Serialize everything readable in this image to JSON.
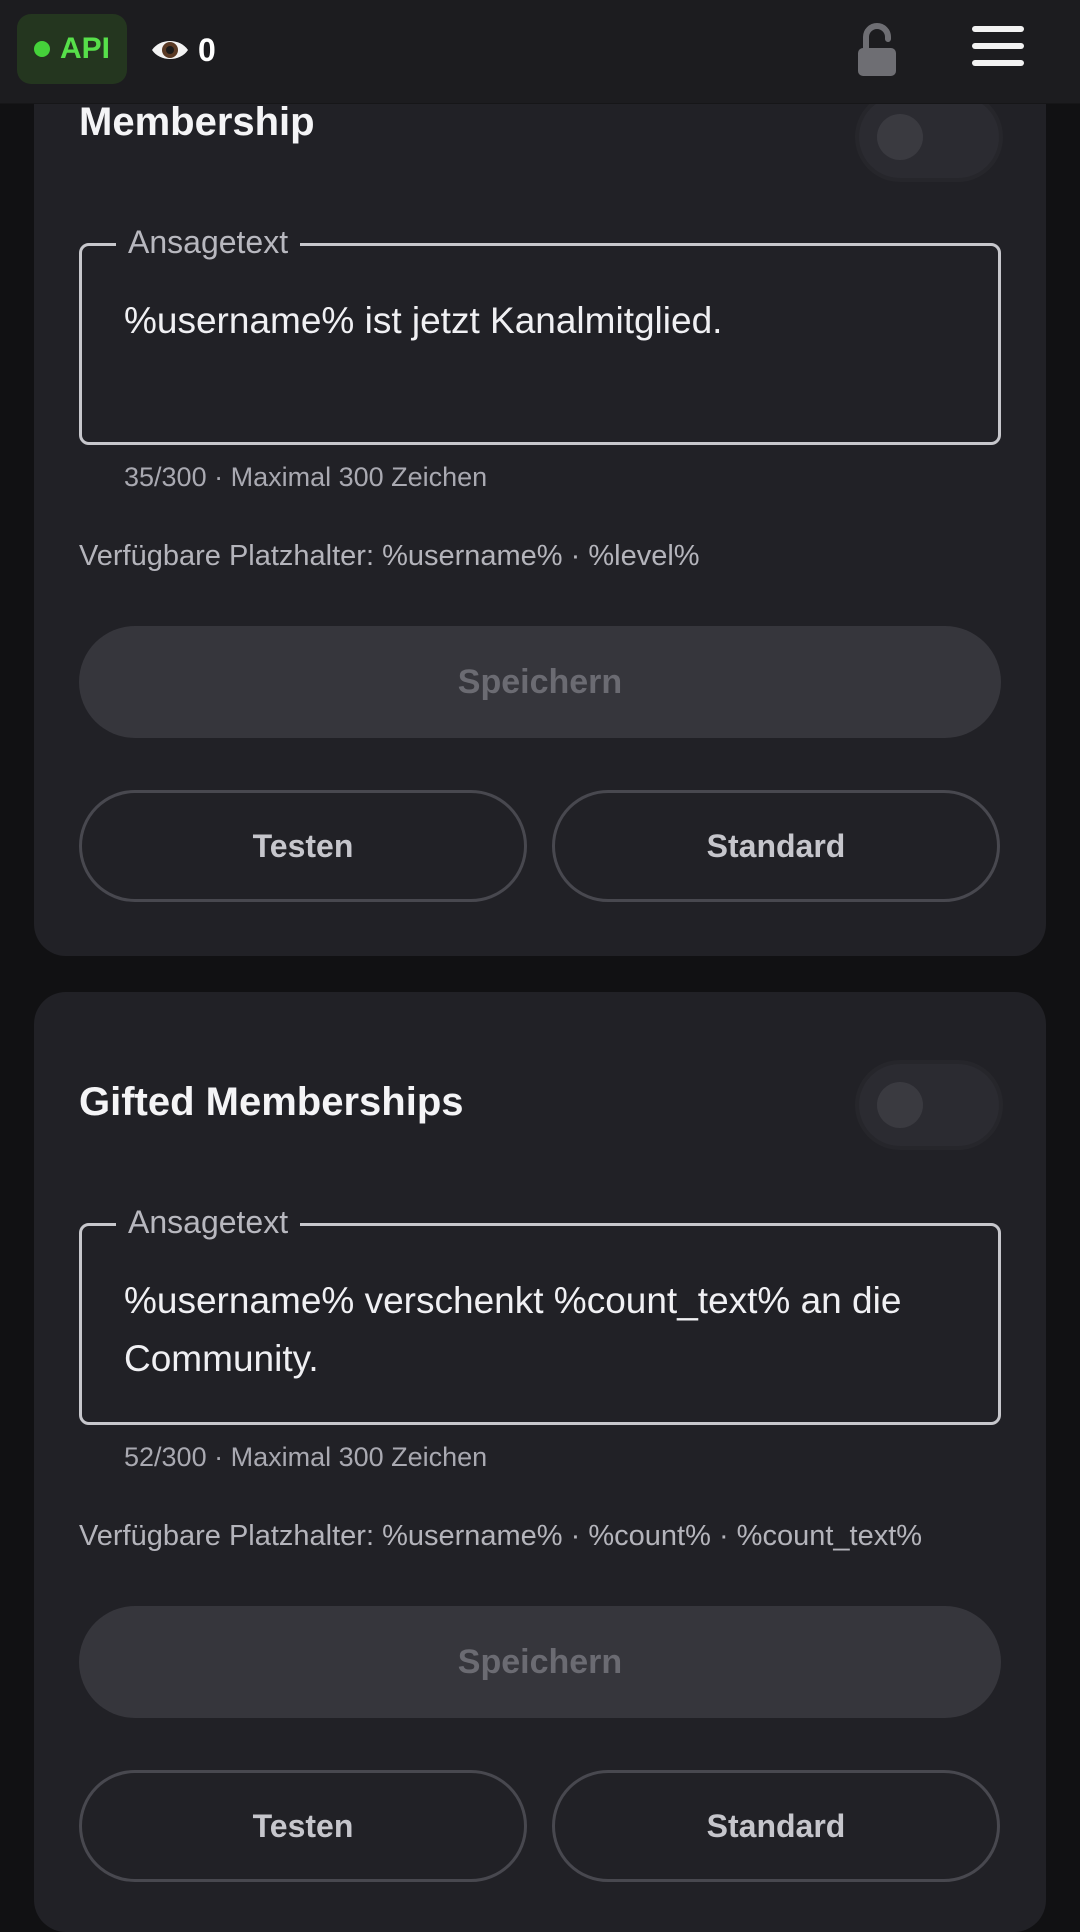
{
  "topbar": {
    "api_label": "API",
    "viewer_count": "0",
    "icons": [
      "eye-icon",
      "unlock-icon",
      "hamburger-menu-icon"
    ],
    "colors": {
      "api_green": "#57e04a",
      "api_badge_bg": "#24361f"
    }
  },
  "cards": [
    {
      "title": "Membership",
      "toggle_on": false,
      "field_label": "Ansagetext",
      "field_value": "%username% ist jetzt Kanalmitglied.",
      "counter": "35/300 · Maximal 300 Zeichen",
      "placeholders": "Verfügbare Platzhalter: %username% · %level%",
      "save_label": "Speichern",
      "test_label": "Testen",
      "default_label": "Standard"
    },
    {
      "title": "Gifted Memberships",
      "toggle_on": false,
      "field_label": "Ansagetext",
      "field_value": "%username% verschenkt %count_text% an die Community.",
      "counter": "52/300 · Maximal 300 Zeichen",
      "placeholders": "Verfügbare Platzhalter: %username% · %count% · %count_text%",
      "save_label": "Speichern",
      "test_label": "Testen",
      "default_label": "Standard"
    }
  ]
}
